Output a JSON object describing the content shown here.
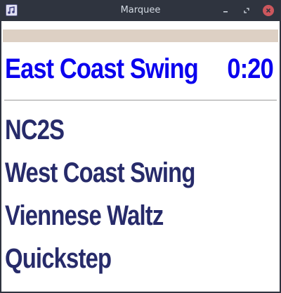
{
  "window": {
    "title": "Marquee",
    "icon": "music-note-icon",
    "controls": [
      "minimize-icon",
      "maximize-icon",
      "close-icon"
    ]
  },
  "progress": {
    "fraction": 1.0,
    "color": "#ddd0c4"
  },
  "now_playing": {
    "dance": "East Coast Swing",
    "time": "0:20",
    "color": "#0a00ee"
  },
  "queue": {
    "color": "#272b6a",
    "items": [
      {
        "label": "NC2S"
      },
      {
        "label": "West Coast Swing"
      },
      {
        "label": "Viennese Waltz"
      },
      {
        "label": "Quickstep"
      }
    ]
  }
}
